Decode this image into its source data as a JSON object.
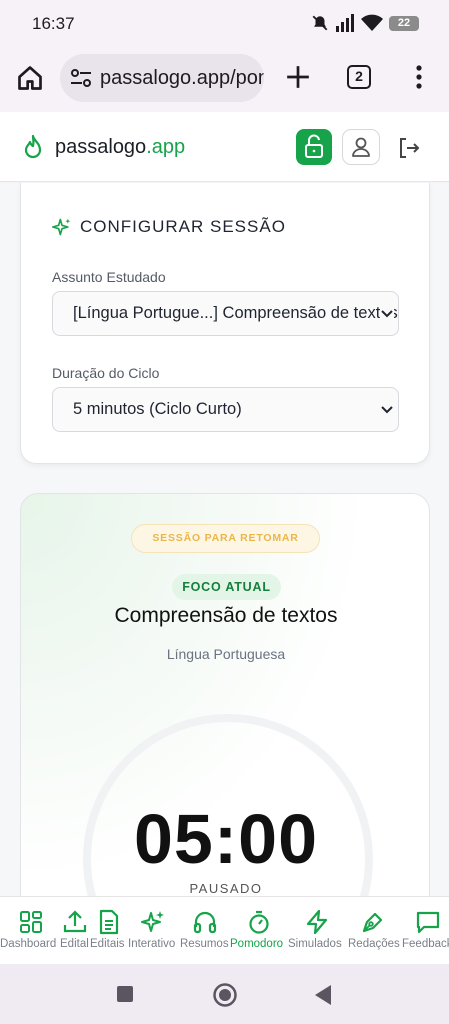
{
  "status_bar": {
    "time": "16:37",
    "battery": "22"
  },
  "browser": {
    "url": "passalogo.app/pomodoro",
    "tab_count": "2",
    "icons": [
      "home-icon",
      "site-settings-icon",
      "new-tab-icon",
      "tab-switcher-icon",
      "more-menu-icon"
    ]
  },
  "header": {
    "brand_name": "passalogo",
    "brand_tld": ".app",
    "icons": [
      "flame-logo-icon",
      "unlock-icon",
      "user-icon",
      "logout-icon"
    ],
    "accent_color": "#16a34a"
  },
  "config": {
    "title": "CONFIGURAR SESSÃO",
    "subject_label": "Assunto Estudado",
    "subject_value": "[Língua Portugue...] Compreensão de textos",
    "duration_label": "Duração do Ciclo",
    "duration_value": "5 minutos (Ciclo Curto)"
  },
  "session": {
    "resume_badge": "SESSÃO PARA RETOMAR",
    "focus_badge": "FOCO ATUAL",
    "topic": "Compreensão de textos",
    "subject": "Língua Portuguesa",
    "timer_minutes": "05",
    "timer_separator": ":",
    "timer_seconds": "00",
    "status": "PAUSADO"
  },
  "bottom_nav": [
    {
      "label": "Dashboard",
      "icon": "grid-icon"
    },
    {
      "label": "Edital",
      "icon": "upload-icon"
    },
    {
      "label": "Editais",
      "icon": "document-icon"
    },
    {
      "label": "Interativo",
      "icon": "sparkles-icon"
    },
    {
      "label": "Resumos",
      "icon": "headphones-icon"
    },
    {
      "label": "Pomodoro",
      "icon": "timer-icon",
      "active": true
    },
    {
      "label": "Simulados",
      "icon": "zap-icon"
    },
    {
      "label": "Redações",
      "icon": "pen-icon"
    },
    {
      "label": "Feedback",
      "icon": "message-icon"
    }
  ]
}
